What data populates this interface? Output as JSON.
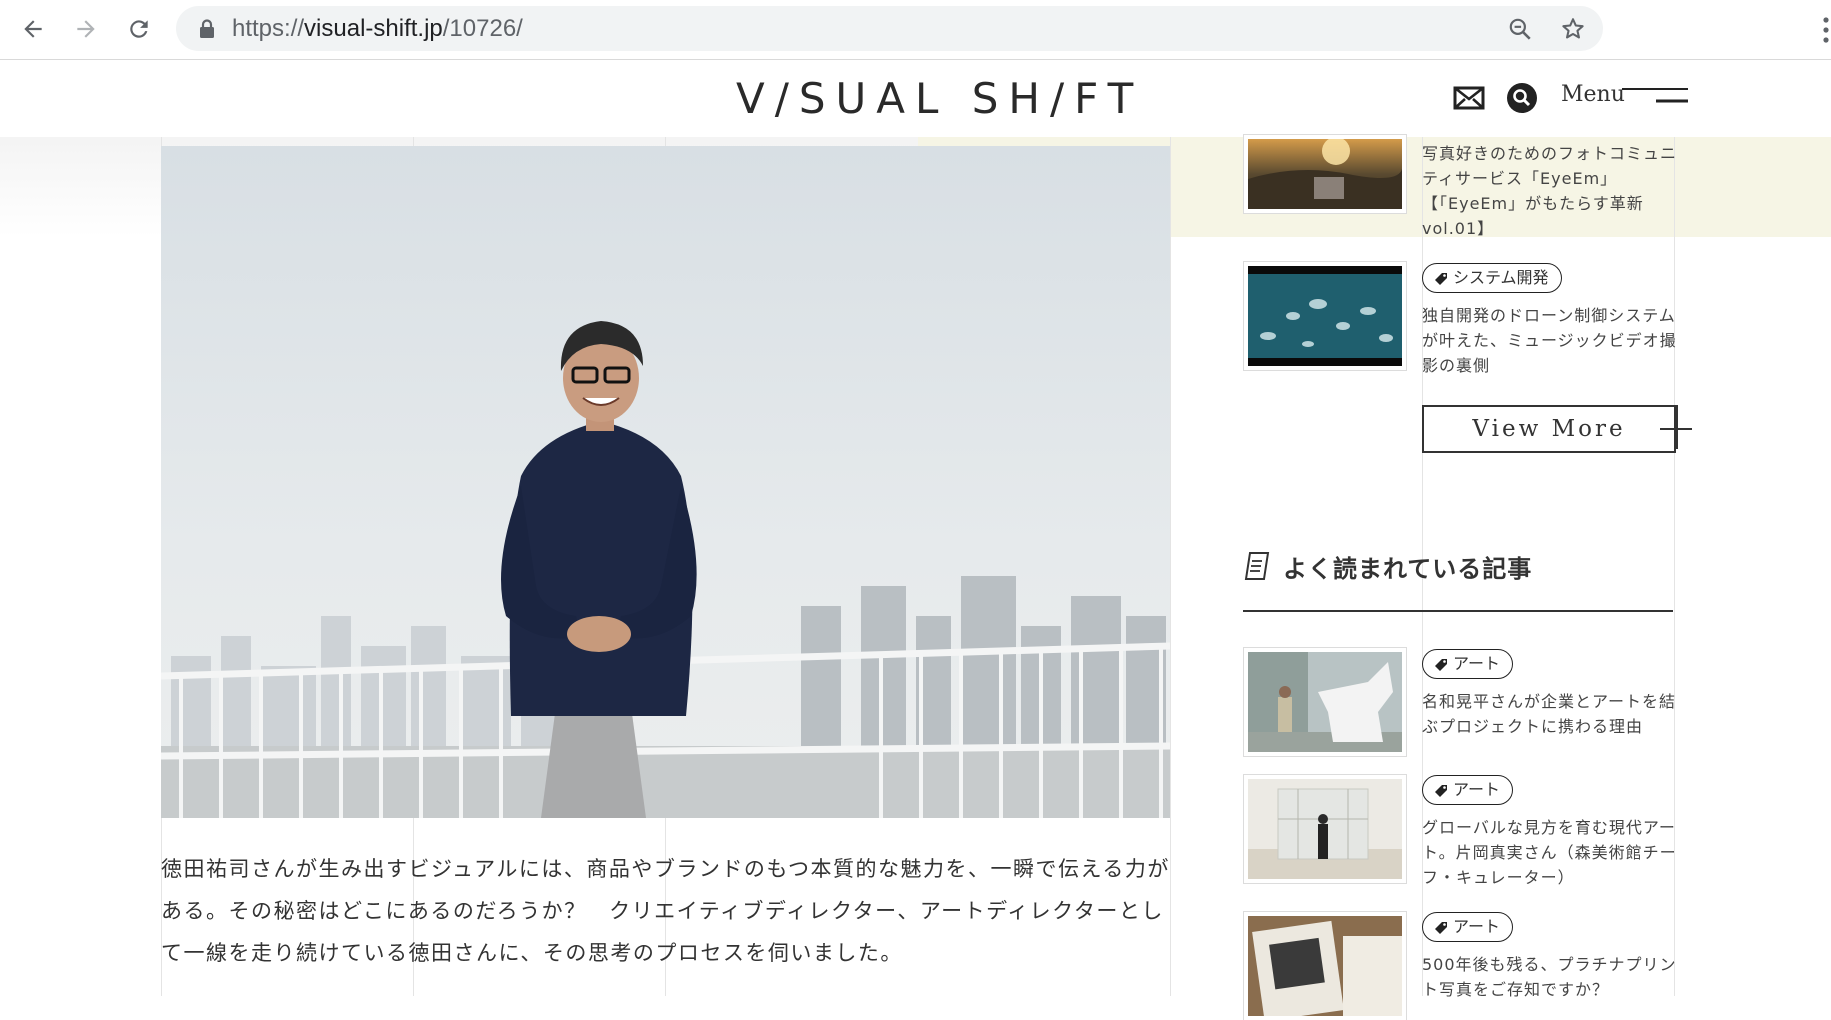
{
  "browser": {
    "url_scheme": "https://",
    "url_host": "visual-shift.jp",
    "url_path": "/10726/"
  },
  "header": {
    "logo": "V/SUAL SH/FT",
    "menu_label": "Menu"
  },
  "intro": {
    "text": "徳田祐司さんが生み出すビジュアルには、商品やブランドのもつ本質的な魅力を、一瞬で伝える力がある。その秘密はどこにあるのだろうか？　クリエイティブディレクター、アートディレクターとして一線を走り続けている徳田さんに、その思考のプロセスを伺いました。"
  },
  "sidebar": {
    "related": [
      {
        "title": "写真好きのためのフォトコミュニティサービス「EyeEm」【「EyeEm」がもたらす革新vol.01】"
      },
      {
        "tag": "システム開発",
        "title": "独自開発のドローン制御システムが叶えた、ミュージックビデオ撮影の裏側"
      }
    ],
    "view_more": "View More",
    "popular_title": "よく読まれている記事",
    "popular": [
      {
        "tag": "アート",
        "title": "名和晃平さんが企業とアートを結ぶプロジェクトに携わる理由"
      },
      {
        "tag": "アート",
        "title": "グローバルな見方を育む現代アート。片岡真実さん（森美術館チーフ・キュレーター）"
      },
      {
        "tag": "アート",
        "title": "500年後も残る、プラチナプリント写真をご存知ですか？"
      }
    ]
  },
  "colors": {
    "cream": "#f6f5e5",
    "text": "#333333",
    "chrome_bg": "#f1f3f4"
  }
}
